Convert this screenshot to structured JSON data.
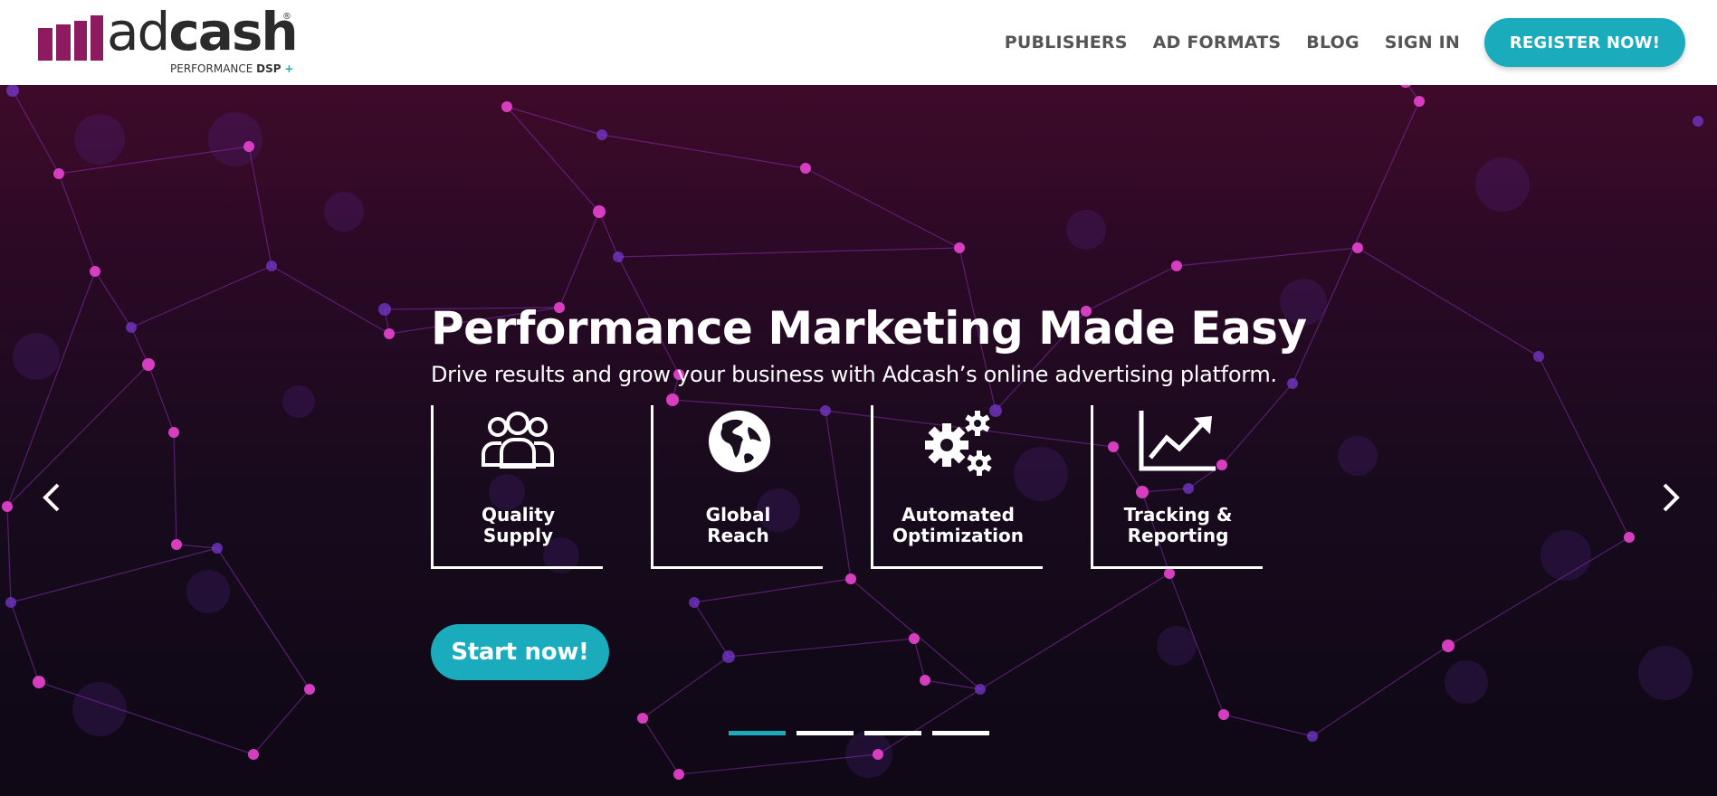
{
  "header": {
    "logo": {
      "word_ad": "ad",
      "word_cash": "cash",
      "registered": "®",
      "tagline_prefix": "PERFORMANCE ",
      "tagline_bold": "DSP",
      "tagline_plus": "+"
    },
    "nav": {
      "publishers": "PUBLISHERS",
      "ad_formats": "AD FORMATS",
      "blog": "BLOG",
      "sign_in": "SIGN IN",
      "register": "REGISTER NOW!"
    }
  },
  "hero": {
    "title": "Performance Marketing Made Easy",
    "subtitle": "Drive results and grow your business with Adcash’s online advertising platform.",
    "features": [
      {
        "label": "Quality\nSupply",
        "icon": "users-icon"
      },
      {
        "label": "Global\nReach",
        "icon": "globe-icon"
      },
      {
        "label": "Automated\nOptimization",
        "icon": "gears-icon"
      },
      {
        "label": "Tracking &\nReporting",
        "icon": "chart-icon"
      }
    ],
    "cta": "Start now!",
    "slides": {
      "count": 4,
      "active_index": 0
    }
  },
  "colors": {
    "accent": "#1aacbd",
    "brand": "#8e1a5f",
    "nav_text": "#555555",
    "node": "#e040c8"
  }
}
